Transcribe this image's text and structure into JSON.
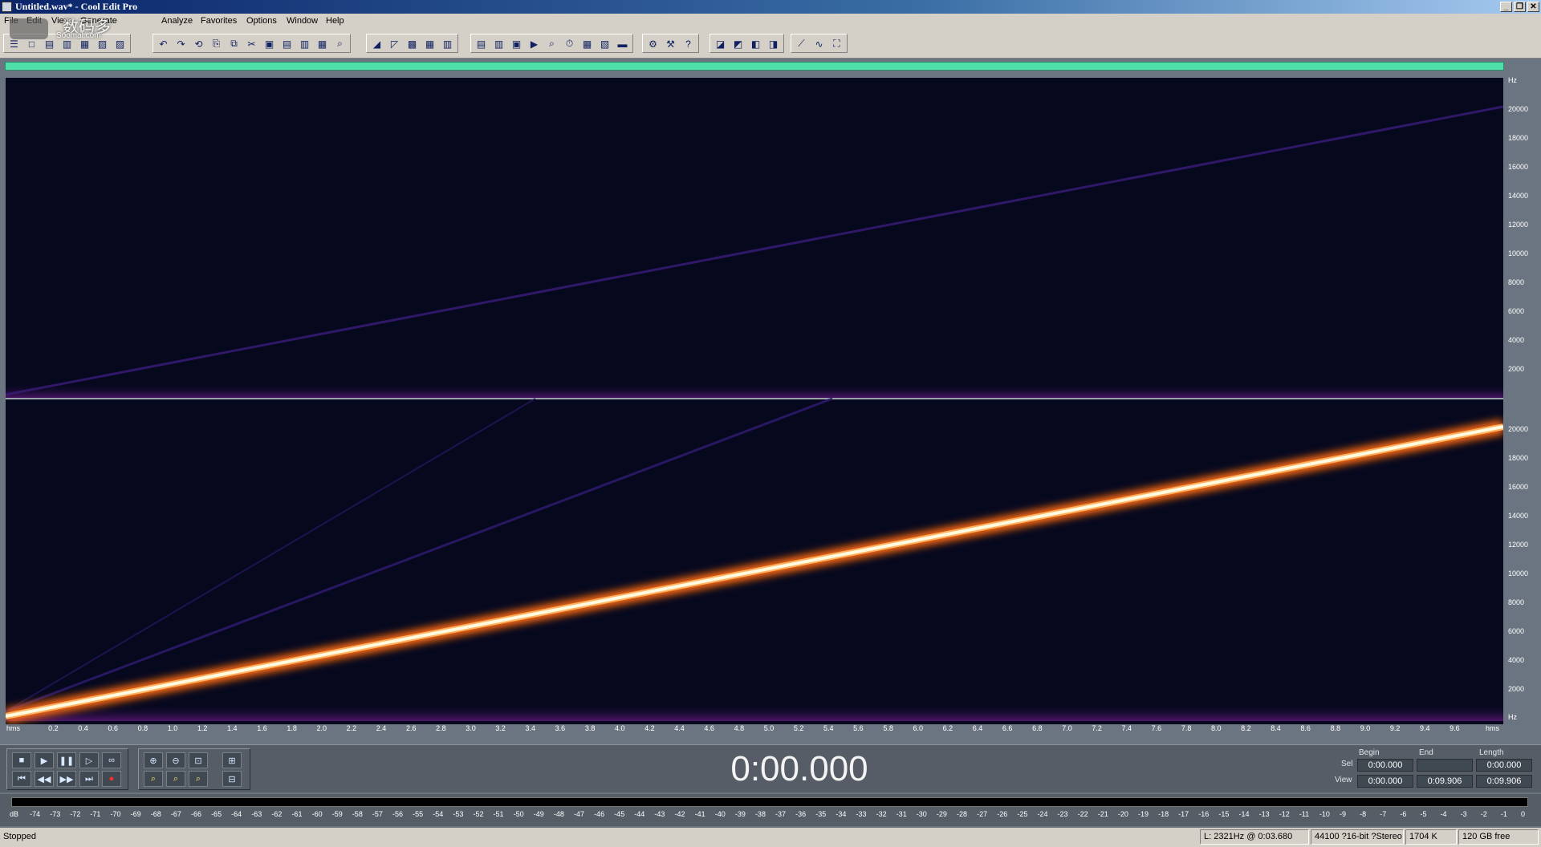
{
  "window": {
    "title": "Untitled.wav* - Cool Edit Pro",
    "buttons": [
      "_",
      "❐",
      "✕"
    ]
  },
  "watermark": {
    "text": "数码多",
    "sub": "Soomal.com"
  },
  "menu": [
    "File",
    "Edit",
    "View",
    "Generate",
    "Analyze",
    "Favorites",
    "Options",
    "Window",
    "Help"
  ],
  "spectrogram": {
    "frequency_unit": "Hz",
    "frequency_labels": [
      "20000",
      "18000",
      "16000",
      "14000",
      "12000",
      "10000",
      "8000",
      "6000",
      "4000",
      "2000"
    ],
    "time_unit": "hms",
    "time_labels": [
      "0.2",
      "0.4",
      "0.6",
      "0.8",
      "1.0",
      "1.2",
      "1.4",
      "1.6",
      "1.8",
      "2.0",
      "2.2",
      "2.4",
      "2.6",
      "2.8",
      "3.0",
      "3.2",
      "3.4",
      "3.6",
      "3.8",
      "4.0",
      "4.2",
      "4.4",
      "4.6",
      "4.8",
      "5.0",
      "5.2",
      "5.4",
      "5.6",
      "5.8",
      "6.0",
      "6.2",
      "6.4",
      "6.6",
      "6.8",
      "7.0",
      "7.2",
      "7.4",
      "7.6",
      "7.8",
      "8.0",
      "8.2",
      "8.4",
      "8.6",
      "8.8",
      "9.0",
      "9.2",
      "9.4",
      "9.6"
    ],
    "colors": {
      "background": "#06081e",
      "sweep_core": "#fffbe0",
      "sweep_glow": "#ff7a20",
      "faint": "#3a1c7a"
    }
  },
  "transport": {
    "time": "0:00.000"
  },
  "selection": {
    "headers": {
      "begin": "Begin",
      "end": "End",
      "length": "Length"
    },
    "sel_label": "Sel",
    "view_label": "View",
    "sel": {
      "begin": "0:00.000",
      "end": "",
      "length": "0:00.000"
    },
    "view": {
      "begin": "0:00.000",
      "end": "0:09.906",
      "length": "0:09.906"
    }
  },
  "meter": {
    "labels": [
      "dB",
      "-74",
      "-73",
      "-72",
      "-71",
      "-70",
      "-69",
      "-68",
      "-67",
      "-66",
      "-65",
      "-64",
      "-63",
      "-62",
      "-61",
      "-60",
      "-59",
      "-58",
      "-57",
      "-56",
      "-55",
      "-54",
      "-53",
      "-52",
      "-51",
      "-50",
      "-49",
      "-48",
      "-47",
      "-46",
      "-45",
      "-44",
      "-43",
      "-42",
      "-41",
      "-40",
      "-39",
      "-38",
      "-37",
      "-36",
      "-35",
      "-34",
      "-33",
      "-32",
      "-31",
      "-30",
      "-29",
      "-28",
      "-27",
      "-26",
      "-25",
      "-24",
      "-23",
      "-22",
      "-21",
      "-20",
      "-19",
      "-18",
      "-17",
      "-16",
      "-15",
      "-14",
      "-13",
      "-12",
      "-11",
      "-10",
      "-9",
      "-8",
      "-7",
      "-6",
      "-5",
      "-4",
      "-3",
      "-2",
      "-1",
      "0"
    ]
  },
  "status": {
    "text": "Stopped",
    "cursor": "L: 2321Hz @  0:03.680",
    "format": "44100 ?16-bit ?Stereo",
    "size": "1704 K",
    "free": "120 GB free"
  }
}
